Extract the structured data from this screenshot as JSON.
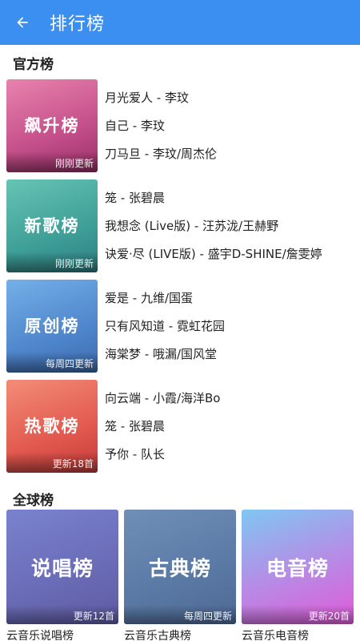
{
  "appbar": {
    "title": "排行榜",
    "back_icon": "arrow-left-icon"
  },
  "sections": {
    "official": "官方榜",
    "global": "全球榜"
  },
  "official_charts": [
    {
      "name": "飙升榜",
      "update": "刚刚更新",
      "songs": [
        "月光爱人 - 李玟",
        "自己 - 李玟",
        "刀马旦 - 李玟/周杰伦"
      ]
    },
    {
      "name": "新歌榜",
      "update": "刚刚更新",
      "songs": [
        "笼 - 张碧晨",
        "我想念 (Live版) - 汪苏泷/王赫野",
        "诀爱·尽 (LIVE版) - 盛宇D-SHINE/詹雯婷"
      ]
    },
    {
      "name": "原创榜",
      "update": "每周四更新",
      "songs": [
        "爱是 - 九维/国蛋",
        "只有风知道 - 霓虹花园",
        "海棠梦 - 哦漏/国风堂"
      ]
    },
    {
      "name": "热歌榜",
      "update": "更新18首",
      "songs": [
        "向云端 - 小霞/海洋Bo",
        "笼 - 张碧晨",
        "予你 - 队长"
      ]
    }
  ],
  "global_charts": [
    {
      "name": "说唱榜",
      "update": "更新12首",
      "caption": "云音乐说唱榜"
    },
    {
      "name": "古典榜",
      "update": "每周四更新",
      "caption": "云音乐古典榜"
    },
    {
      "name": "电音榜",
      "update": "更新20首",
      "caption": "云音乐电音榜"
    }
  ]
}
